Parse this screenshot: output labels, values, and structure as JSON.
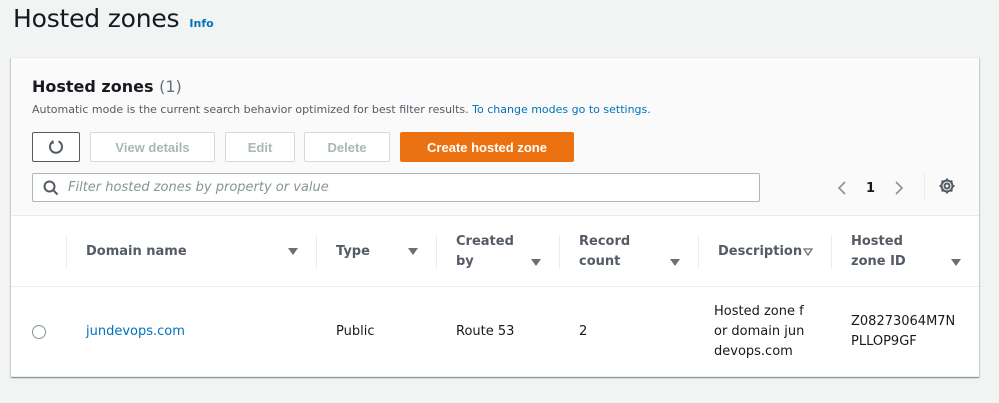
{
  "page": {
    "title": "Hosted zones",
    "info": "Info"
  },
  "container": {
    "title": "Hosted zones",
    "count": "(1)",
    "description": "Automatic mode is the current search behavior optimized for best filter results.",
    "description_link": "To change modes go to settings."
  },
  "toolbar": {
    "refresh_icon": "refresh-icon",
    "view_details": "View details",
    "edit": "Edit",
    "delete": "Delete",
    "create": "Create hosted zone"
  },
  "search": {
    "placeholder": "Filter hosted zones by property or value",
    "icon": "search-icon"
  },
  "pagination": {
    "current_page": "1"
  },
  "table": {
    "columns": [
      {
        "label": "Domain name"
      },
      {
        "label": "Type"
      },
      {
        "label": "Created by"
      },
      {
        "label": "Record count"
      },
      {
        "label": "Description"
      },
      {
        "label": "Hosted zone ID"
      }
    ],
    "rows": [
      {
        "domain_name": "jundevops.com",
        "type": "Public",
        "created_by": "Route 53",
        "record_count": "2",
        "description": "Hosted zone for domain jundevops.com",
        "zone_id": "Z08273064M7NPLLOP9GF"
      }
    ]
  },
  "colors": {
    "accent": "#0073bb",
    "primary_button": "#ec7211",
    "background": "#f2f3f3"
  }
}
